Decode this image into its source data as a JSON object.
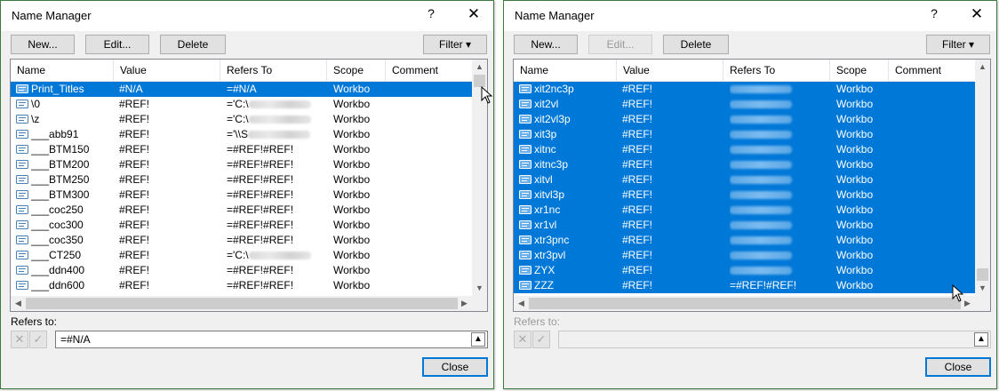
{
  "dialogs": [
    {
      "title": "Name Manager",
      "help_label": "?",
      "close_label": "✕",
      "buttons": {
        "new": "New...",
        "edit": "Edit...",
        "delete": "Delete",
        "filter": "Filter ▾",
        "close": "Close"
      },
      "edit_disabled": false,
      "columns": [
        "Name",
        "Value",
        "Refers To",
        "Scope",
        "Comment"
      ],
      "rows": [
        {
          "name": "Print_Titles",
          "value": "#N/A",
          "refers": "=#N/A",
          "scope": "Workbo",
          "selected": true
        },
        {
          "name": "\\0",
          "value": "#REF!",
          "refers": "='C:\\",
          "scope": "Workbo",
          "blurred": true
        },
        {
          "name": "\\z",
          "value": "#REF!",
          "refers": "='C:\\",
          "scope": "Workbo",
          "blurred": true
        },
        {
          "name": "___abb91",
          "value": "#REF!",
          "refers": "='\\\\S",
          "scope": "Workbo",
          "blurred": true
        },
        {
          "name": "___BTM150",
          "value": "#REF!",
          "refers": "=#REF!#REF!",
          "scope": "Workbo"
        },
        {
          "name": "___BTM200",
          "value": "#REF!",
          "refers": "=#REF!#REF!",
          "scope": "Workbo"
        },
        {
          "name": "___BTM250",
          "value": "#REF!",
          "refers": "=#REF!#REF!",
          "scope": "Workbo"
        },
        {
          "name": "___BTM300",
          "value": "#REF!",
          "refers": "=#REF!#REF!",
          "scope": "Workbo"
        },
        {
          "name": "___coc250",
          "value": "#REF!",
          "refers": "=#REF!#REF!",
          "scope": "Workbo"
        },
        {
          "name": "___coc300",
          "value": "#REF!",
          "refers": "=#REF!#REF!",
          "scope": "Workbo"
        },
        {
          "name": "___coc350",
          "value": "#REF!",
          "refers": "=#REF!#REF!",
          "scope": "Workbo"
        },
        {
          "name": "___CT250",
          "value": "#REF!",
          "refers": "='C:\\",
          "scope": "Workbo",
          "blurred": true
        },
        {
          "name": "___ddn400",
          "value": "#REF!",
          "refers": "=#REF!#REF!",
          "scope": "Workbo"
        },
        {
          "name": "___ddn600",
          "value": "#REF!",
          "refers": "=#REF!#REF!",
          "scope": "Workbo"
        }
      ],
      "scroll_position": 0.0,
      "refers_to_label": "Refers to:",
      "refers_to_value": "=#N/A",
      "refers_to_disabled": false
    },
    {
      "title": "Name Manager",
      "help_label": "?",
      "close_label": "✕",
      "buttons": {
        "new": "New...",
        "edit": "Edit...",
        "delete": "Delete",
        "filter": "Filter ▾",
        "close": "Close"
      },
      "edit_disabled": true,
      "columns": [
        "Name",
        "Value",
        "Refers To",
        "Scope",
        "Comment"
      ],
      "rows": [
        {
          "name": "xit2nc3p",
          "value": "#REF!",
          "refers": "",
          "scope": "Workbo",
          "selected": true,
          "blurred": true
        },
        {
          "name": "xit2vl",
          "value": "#REF!",
          "refers": "",
          "scope": "Workbo",
          "selected": true,
          "blurred": true
        },
        {
          "name": "xit2vl3p",
          "value": "#REF!",
          "refers": "",
          "scope": "Workbo",
          "selected": true,
          "blurred": true
        },
        {
          "name": "xit3p",
          "value": "#REF!",
          "refers": "",
          "scope": "Workbo",
          "selected": true,
          "blurred": true
        },
        {
          "name": "xitnc",
          "value": "#REF!",
          "refers": "",
          "scope": "Workbo",
          "selected": true,
          "blurred": true
        },
        {
          "name": "xitnc3p",
          "value": "#REF!",
          "refers": "",
          "scope": "Workbo",
          "selected": true,
          "blurred": true
        },
        {
          "name": "xitvl",
          "value": "#REF!",
          "refers": "",
          "scope": "Workbo",
          "selected": true,
          "blurred": true
        },
        {
          "name": "xitvl3p",
          "value": "#REF!",
          "refers": "",
          "scope": "Workbo",
          "selected": true,
          "blurred": true
        },
        {
          "name": "xr1nc",
          "value": "#REF!",
          "refers": "",
          "scope": "Workbo",
          "selected": true,
          "blurred": true
        },
        {
          "name": "xr1vl",
          "value": "#REF!",
          "refers": "",
          "scope": "Workbo",
          "selected": true,
          "blurred": true
        },
        {
          "name": "xtr3pnc",
          "value": "#REF!",
          "refers": "",
          "scope": "Workbo",
          "selected": true,
          "blurred": true
        },
        {
          "name": "xtr3pvl",
          "value": "#REF!",
          "refers": "",
          "scope": "Workbo",
          "selected": true,
          "blurred": true
        },
        {
          "name": "ZYX",
          "value": "#REF!",
          "refers": "",
          "scope": "Workbo",
          "selected": true,
          "blurred": true
        },
        {
          "name": "ZZZ",
          "value": "#REF!",
          "refers": "=#REF!#REF!",
          "scope": "Workbo",
          "selected": true
        }
      ],
      "scroll_position": 1.0,
      "refers_to_label": "Refers to:",
      "refers_to_value": "",
      "refers_to_disabled": true
    }
  ],
  "icons": {
    "name_icon": "defined-name-icon",
    "cancel": "cancel-x-icon",
    "confirm": "confirm-check-icon",
    "collapse": "collapse-dialog-icon",
    "cursor": "mouse-pointer-icon"
  },
  "colors": {
    "selection": "#0078d7",
    "dialog_bg": "#f0f0f0",
    "border": "#3d7a3d"
  }
}
